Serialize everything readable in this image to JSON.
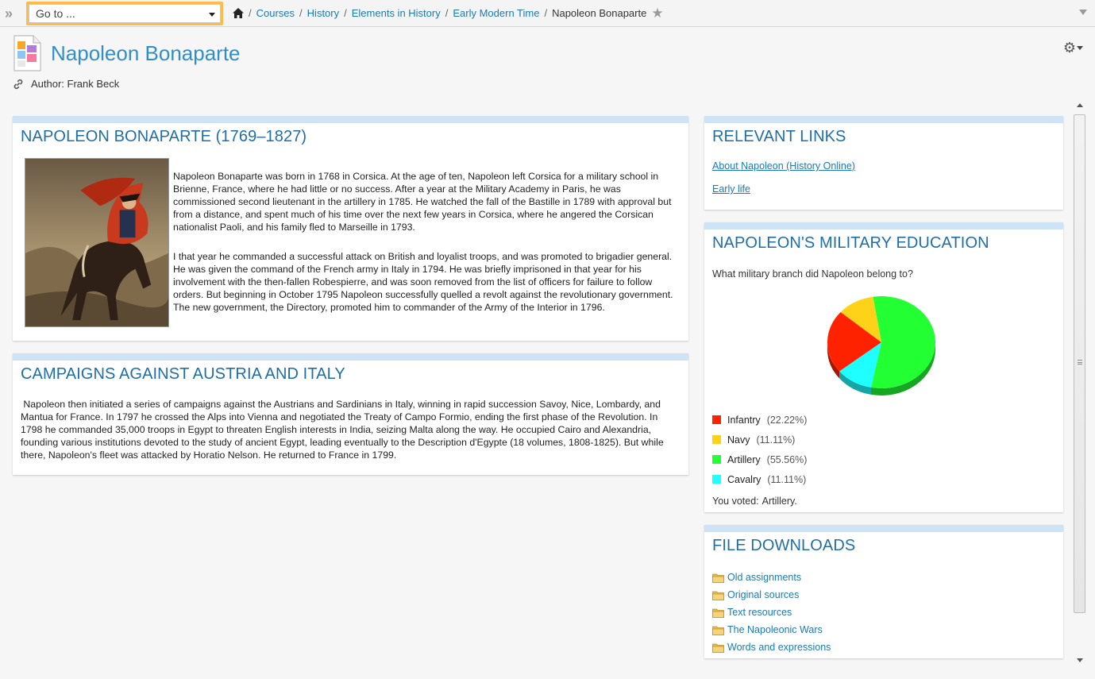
{
  "nav": {
    "goto_placeholder": "Go to ...",
    "breadcrumbs": [
      {
        "label": "Courses"
      },
      {
        "label": "History"
      },
      {
        "label": "Elements in History"
      },
      {
        "label": "Early Modern Time"
      }
    ],
    "current": "Napoleon Bonaparte"
  },
  "header": {
    "title": "Napoleon Bonaparte",
    "author": "Author: Frank Beck"
  },
  "card_bio": {
    "title": "NAPOLEON BONAPARTE (1769–1827)",
    "paragraphs": [
      "Napoleon Bonaparte was born in 1768 in Corsica. At the age of ten, Napoleon left Corsica for a military school in Brienne, France, where he had little or no success. After a year at the Military Academy in Paris, he was commissioned second lieutenant in the artillery in 1785. He watched the fall of the Bastille in 1789 with approval but from a distance, and spent much of his time over the next few years in Corsica, where he angered the Corsican nationalist Paoli, and his family fled to Marseille in 1793.",
      "I that year he commanded a successful attack on British and loyalist troops, and was promoted to brigadier general. He was given the command of the French army in Italy in 1794. He was briefly imprisoned in that year for his involvement with the then-fallen Robespierre, and was soon removed from the list of officers for failure to follow orders. But beginning in October 1795 Napoleon successfully quelled a revolt against the revolutionary government. The new government, the Directory, promoted him to commander of the Army of the Interior in 1796."
    ]
  },
  "card_campaigns": {
    "title": "CAMPAIGNS AGAINST AUSTRIA AND ITALY",
    "text": " Napoleon then initiated a series of campaigns against the Austrians and Sardinians in Italy, winning in rapid succession Savoy, Nice, Lombardy, and Mantua for France. In 1797 he crossed the Alps into Vienna and negotiated the Treaty of Campo Formio, ending the first phase of the Revolution. In 1798 he commanded 35,000 troops in Egypt to threaten English interests in India, seizing Malta along the way. He occupied Cairo and Alexandria, founding various institutions devoted to the study of ancient Egypt, leading eventually to the Description d'Egypte (18 volumes, 1808-1825). But while there, Napoleon's fleet was attacked by Horatio Nelson. He returned to France in 1799."
  },
  "card_links": {
    "title": "RELEVANT LINKS",
    "links": [
      {
        "label": "About Napoleon (History Online)"
      },
      {
        "label": "Early life"
      }
    ]
  },
  "card_poll": {
    "title": "NAPOLEON'S MILITARY EDUCATION",
    "question": "What military branch did Napoleon belong to?",
    "voted_label": "You voted:",
    "voted_value": "Artillery."
  },
  "chart_data": {
    "type": "pie",
    "title": "",
    "categories": [
      "Infantry",
      "Navy",
      "Artillery",
      "Cavalry"
    ],
    "values": [
      22.22,
      11.11,
      55.56,
      11.11
    ],
    "labels": [
      "(22.22%)",
      "(11.11%)",
      "(55.56%)",
      "(11.11%)"
    ],
    "colors": [
      "#ff2200",
      "#ffd21a",
      "#22ff33",
      "#1fffff"
    ],
    "legend_placement": "bottom"
  },
  "card_files": {
    "title": "FILE DOWNLOADS",
    "files": [
      {
        "label": "Old assignments"
      },
      {
        "label": "Original sources"
      },
      {
        "label": "Text resources"
      },
      {
        "label": "The Napoleonic Wars"
      },
      {
        "label": "Words and expressions"
      }
    ]
  }
}
